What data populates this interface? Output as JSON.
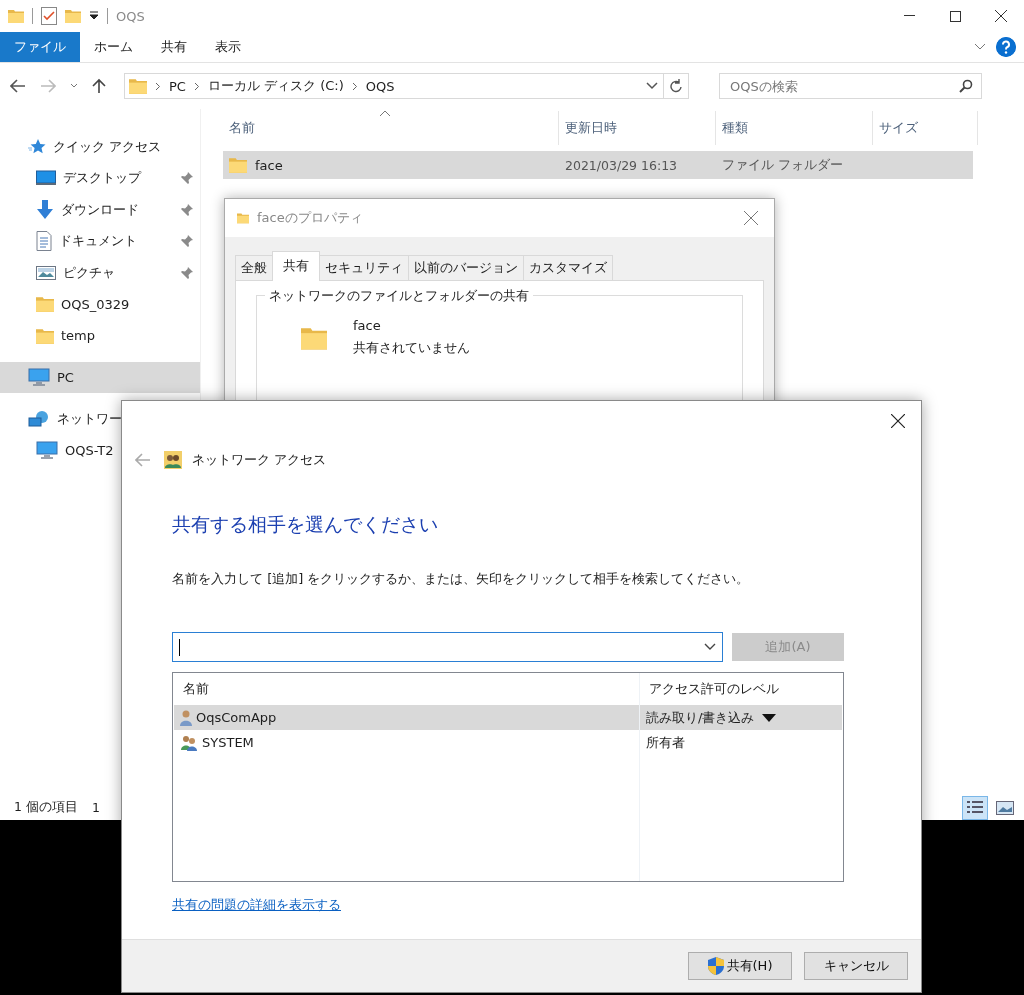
{
  "explorer": {
    "title": "OQS",
    "ribbon_tabs": [
      {
        "label": "ファイル",
        "selected": true
      },
      {
        "label": "ホーム",
        "selected": false
      },
      {
        "label": "共有",
        "selected": false
      },
      {
        "label": "表示",
        "selected": false
      }
    ],
    "breadcrumbs": [
      "PC",
      "ローカル ディスク (C:)",
      "OQS"
    ],
    "search": {
      "placeholder": "OQSの検索"
    },
    "sidebar": {
      "items": [
        {
          "label": "クイック アクセス",
          "kind": "star",
          "selected": false,
          "children": [
            {
              "label": "デスクトップ",
              "kind": "desktop",
              "pinned": true,
              "selected": false
            },
            {
              "label": "ダウンロード",
              "kind": "download",
              "pinned": true,
              "selected": false
            },
            {
              "label": "ドキュメント",
              "kind": "document",
              "pinned": true,
              "selected": false
            },
            {
              "label": "ピクチャ",
              "kind": "pictures",
              "pinned": true,
              "selected": false
            },
            {
              "label": "OQS_0329",
              "kind": "folder",
              "pinned": false,
              "selected": false
            },
            {
              "label": "temp",
              "kind": "folder",
              "pinned": false,
              "selected": false
            }
          ]
        },
        {
          "label": "PC",
          "kind": "pc",
          "selected": true
        },
        {
          "label": "ネットワー",
          "kind": "network",
          "selected": false,
          "children": [
            {
              "label": "OQS-T2",
              "kind": "pc",
              "pinned": false,
              "selected": false
            }
          ]
        }
      ]
    },
    "columns": [
      "名前",
      "更新日時",
      "種類",
      "サイズ"
    ],
    "rows": [
      {
        "name": "face",
        "modified": "2021/03/29 16:13",
        "type": "ファイル フォルダー",
        "selected": true
      }
    ],
    "status_bar": {
      "item_count": "1 個の項目",
      "selection": "1"
    }
  },
  "properties_dialog": {
    "title": "faceのプロパティ",
    "tabs": [
      {
        "label": "全般",
        "selected": false
      },
      {
        "label": "共有",
        "selected": true
      },
      {
        "label": "セキュリティ",
        "selected": false
      },
      {
        "label": "以前のバージョン",
        "selected": false
      },
      {
        "label": "カスタマイズ",
        "selected": false
      }
    ],
    "group_title": "ネットワークのファイルとフォルダーの共有",
    "folder_name": "face",
    "share_status": "共有されていません"
  },
  "network_access_dialog": {
    "title": "ネットワーク アクセス",
    "heading": "共有する相手を選んでください",
    "instruction": "名前を入力して [追加] をクリックするか、または、矢印をクリックして相手を検索してください。",
    "add_button": {
      "label": "追加(A)",
      "disabled": true
    },
    "list": {
      "columns": [
        "名前",
        "アクセス許可のレベル"
      ],
      "rows": [
        {
          "name": "OqsComApp",
          "kind": "user",
          "level": "読み取り/書き込み",
          "dropdown": true,
          "selected": true
        },
        {
          "name": "SYSTEM",
          "kind": "group",
          "level": "所有者",
          "dropdown": false,
          "selected": false
        }
      ]
    },
    "details_link": "共有の問題の詳細を表示する",
    "buttons": [
      {
        "label": "共有(H)",
        "kind": "shield"
      },
      {
        "label": "キャンセル",
        "kind": "plain"
      }
    ]
  }
}
